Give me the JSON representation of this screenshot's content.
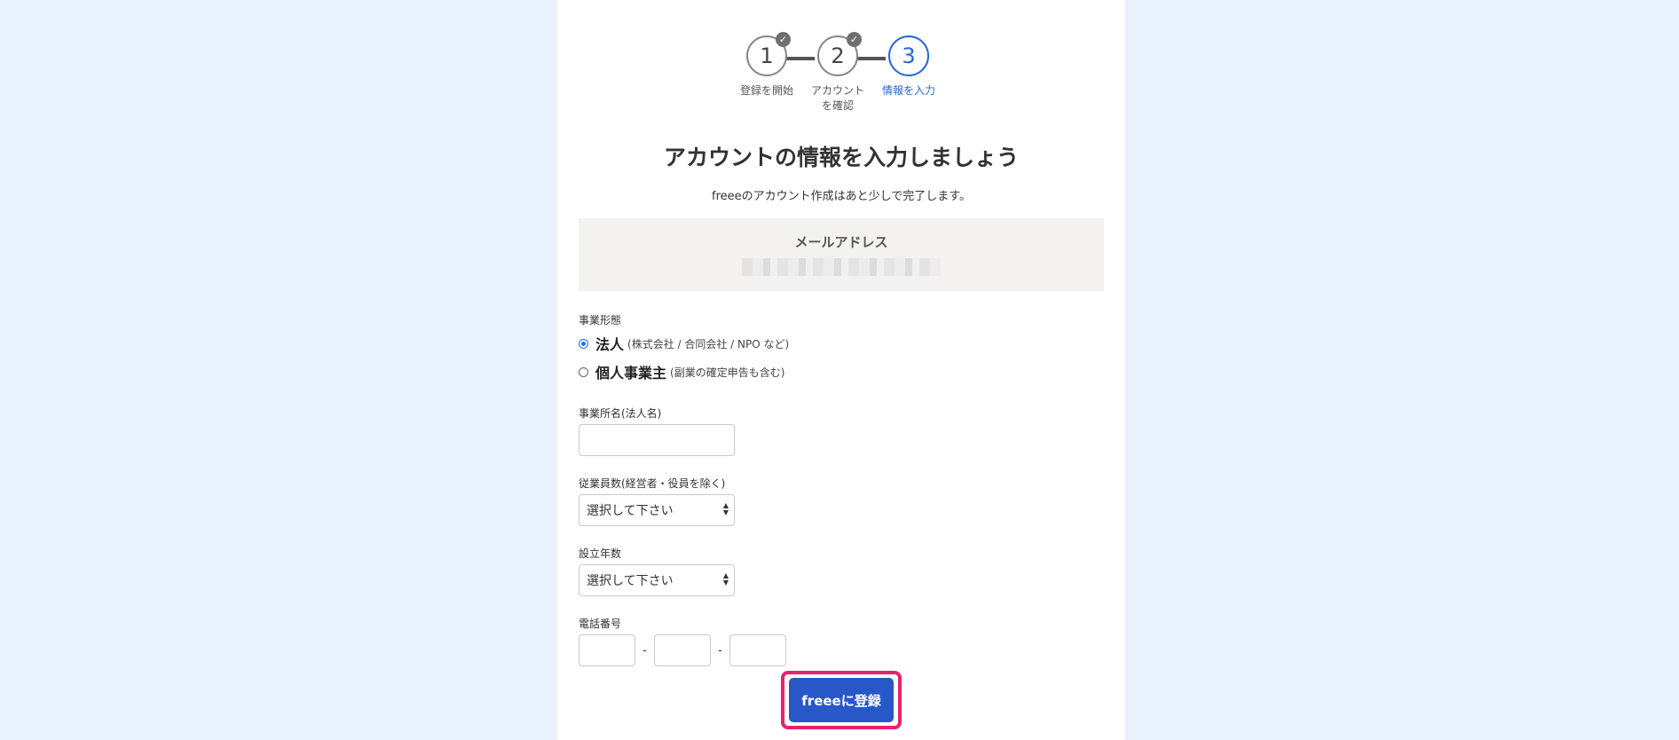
{
  "stepper": {
    "steps": [
      {
        "number": "1",
        "label": "登録を開始",
        "done": true
      },
      {
        "number": "2",
        "label": "アカウント\nを確認",
        "done": true
      },
      {
        "number": "3",
        "label": "情報を入力",
        "done": false
      }
    ],
    "check_glyph": "✓"
  },
  "header": {
    "title": "アカウントの情報を入力しましょう",
    "subtitle": "freeeのアカウント作成はあと少しで完了します。"
  },
  "email": {
    "label": "メールアドレス"
  },
  "form": {
    "business_type": {
      "label": "事業形態",
      "options": [
        {
          "main": "法人",
          "note": "(株式会社 / 合同会社 / NPO など)",
          "selected": true
        },
        {
          "main": "個人事業主",
          "note": "(副業の確定申告も含む)",
          "selected": false
        }
      ]
    },
    "business_name": {
      "label": "事業所名(法人名)",
      "value": ""
    },
    "employees": {
      "label": "従業員数(経営者・役員を除く)",
      "selected": "選択して下さい"
    },
    "years": {
      "label": "設立年数",
      "selected": "選択して下さい"
    },
    "phone": {
      "label": "電話番号",
      "separator": "-"
    }
  },
  "submit": {
    "label": "freeeに登録"
  },
  "colors": {
    "accent": "#2864dc",
    "button": "#2858c8",
    "highlight": "#e8226b",
    "background": "#e9f1fd"
  }
}
